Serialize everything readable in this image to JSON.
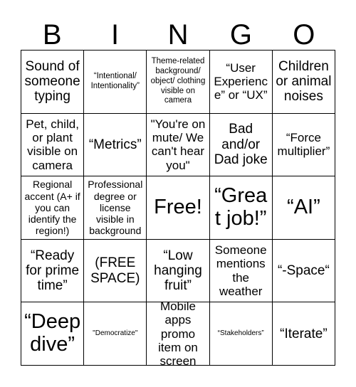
{
  "card": {
    "header_letters": [
      "B",
      "I",
      "N",
      "G",
      "O"
    ],
    "rows": [
      [
        {
          "text": "Sound of someone typing",
          "size": "lg"
        },
        {
          "text": "“Intentional/ Intentionality”",
          "size": "xs"
        },
        {
          "text": "Theme-related background/ object/ clothing visible on camera",
          "size": "xs"
        },
        {
          "text": "“User Experience” or “UX”",
          "size": "md"
        },
        {
          "text": "Children or animal noises",
          "size": "lg"
        }
      ],
      [
        {
          "text": "Pet, child, or plant visible on camera",
          "size": "md"
        },
        {
          "text": "“Metrics”",
          "size": "lg"
        },
        {
          "text": "\"You're on mute/ We can't hear you\"",
          "size": "md"
        },
        {
          "text": "Bad and/or Dad joke",
          "size": "lg"
        },
        {
          "text": "“Force multiplier”",
          "size": "md"
        }
      ],
      [
        {
          "text": "Regional accent (A+ if you can identify the region!)",
          "size": "sm"
        },
        {
          "text": "Professional degree or license visible in background",
          "size": "sm"
        },
        {
          "text": "Free!",
          "size": "xl"
        },
        {
          "text": "“Great job!”",
          "size": "xl"
        },
        {
          "text": "“AI”",
          "size": "xl"
        }
      ],
      [
        {
          "text": "“Ready for prime time”",
          "size": "lg"
        },
        {
          "text": "(FREE SPACE)",
          "size": "lg"
        },
        {
          "text": "“Low hanging fruit”",
          "size": "lg"
        },
        {
          "text": "Someone mentions the weather",
          "size": "md"
        },
        {
          "text": "“-Space“",
          "size": "lg"
        }
      ],
      [
        {
          "text": "“Deep dive”",
          "size": "xl"
        },
        {
          "text": "\"Democratize\"",
          "size": "xxs"
        },
        {
          "text": "Mobile apps promo item on screen",
          "size": "md"
        },
        {
          "text": "“Stakeholders”",
          "size": "xxs"
        },
        {
          "text": "“Iterate”",
          "size": "lg"
        }
      ]
    ]
  }
}
